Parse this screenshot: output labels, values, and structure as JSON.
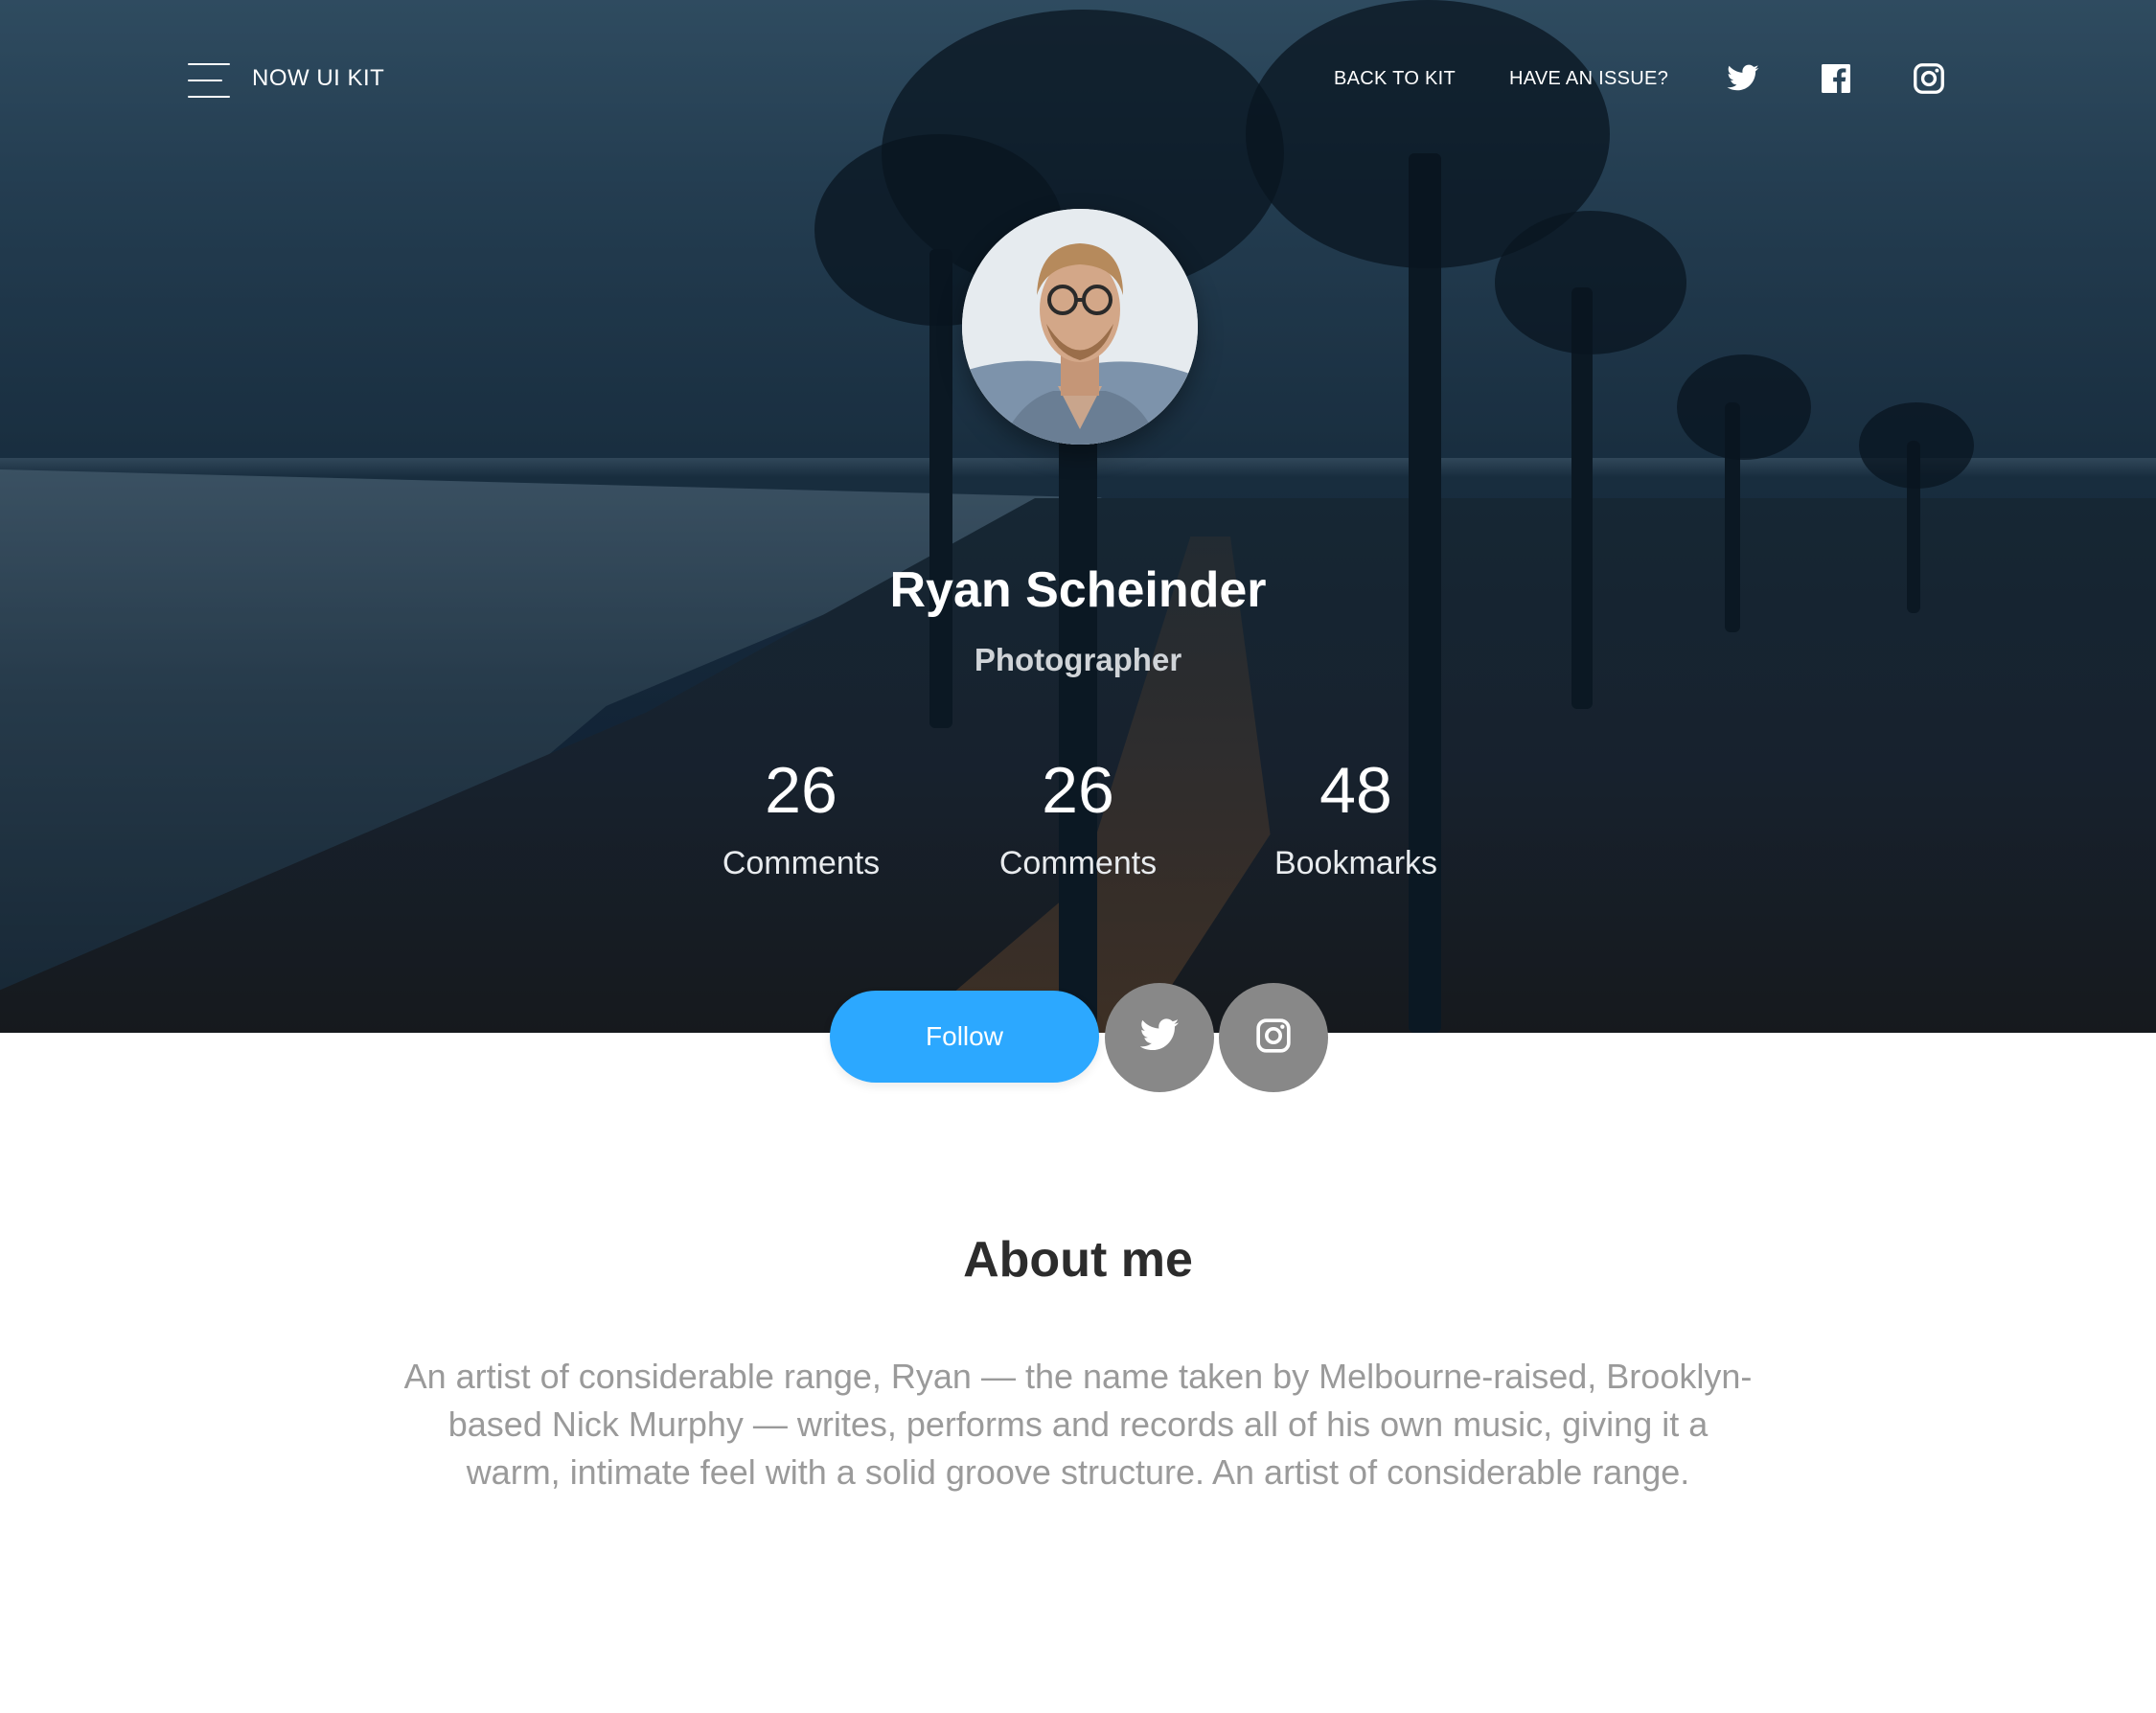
{
  "nav": {
    "brand": "NOW UI KIT",
    "links": [
      "BACK TO KIT",
      "HAVE AN ISSUE?"
    ],
    "icons": [
      "twitter-icon",
      "facebook-icon",
      "instagram-icon"
    ]
  },
  "profile": {
    "name": "Ryan Scheinder",
    "role": "Photographer",
    "stats": [
      {
        "value": "26",
        "label": "Comments"
      },
      {
        "value": "26",
        "label": "Comments"
      },
      {
        "value": "48",
        "label": "Bookmarks"
      }
    ]
  },
  "actions": {
    "follow_label": "Follow",
    "social_buttons": [
      "twitter-icon",
      "instagram-icon"
    ]
  },
  "about": {
    "title": "About me",
    "text": "An artist of considerable range, Ryan — the name taken by Melbourne-raised, Brooklyn-based Nick Murphy — writes, performs and records all of his own music, giving it a warm, intimate feel with a solid groove structure. An artist of considerable range."
  },
  "colors": {
    "primary": "#2ca8ff",
    "neutral_button": "#888888",
    "heading": "#2c2c2c",
    "muted_text": "#9a9a9a"
  }
}
